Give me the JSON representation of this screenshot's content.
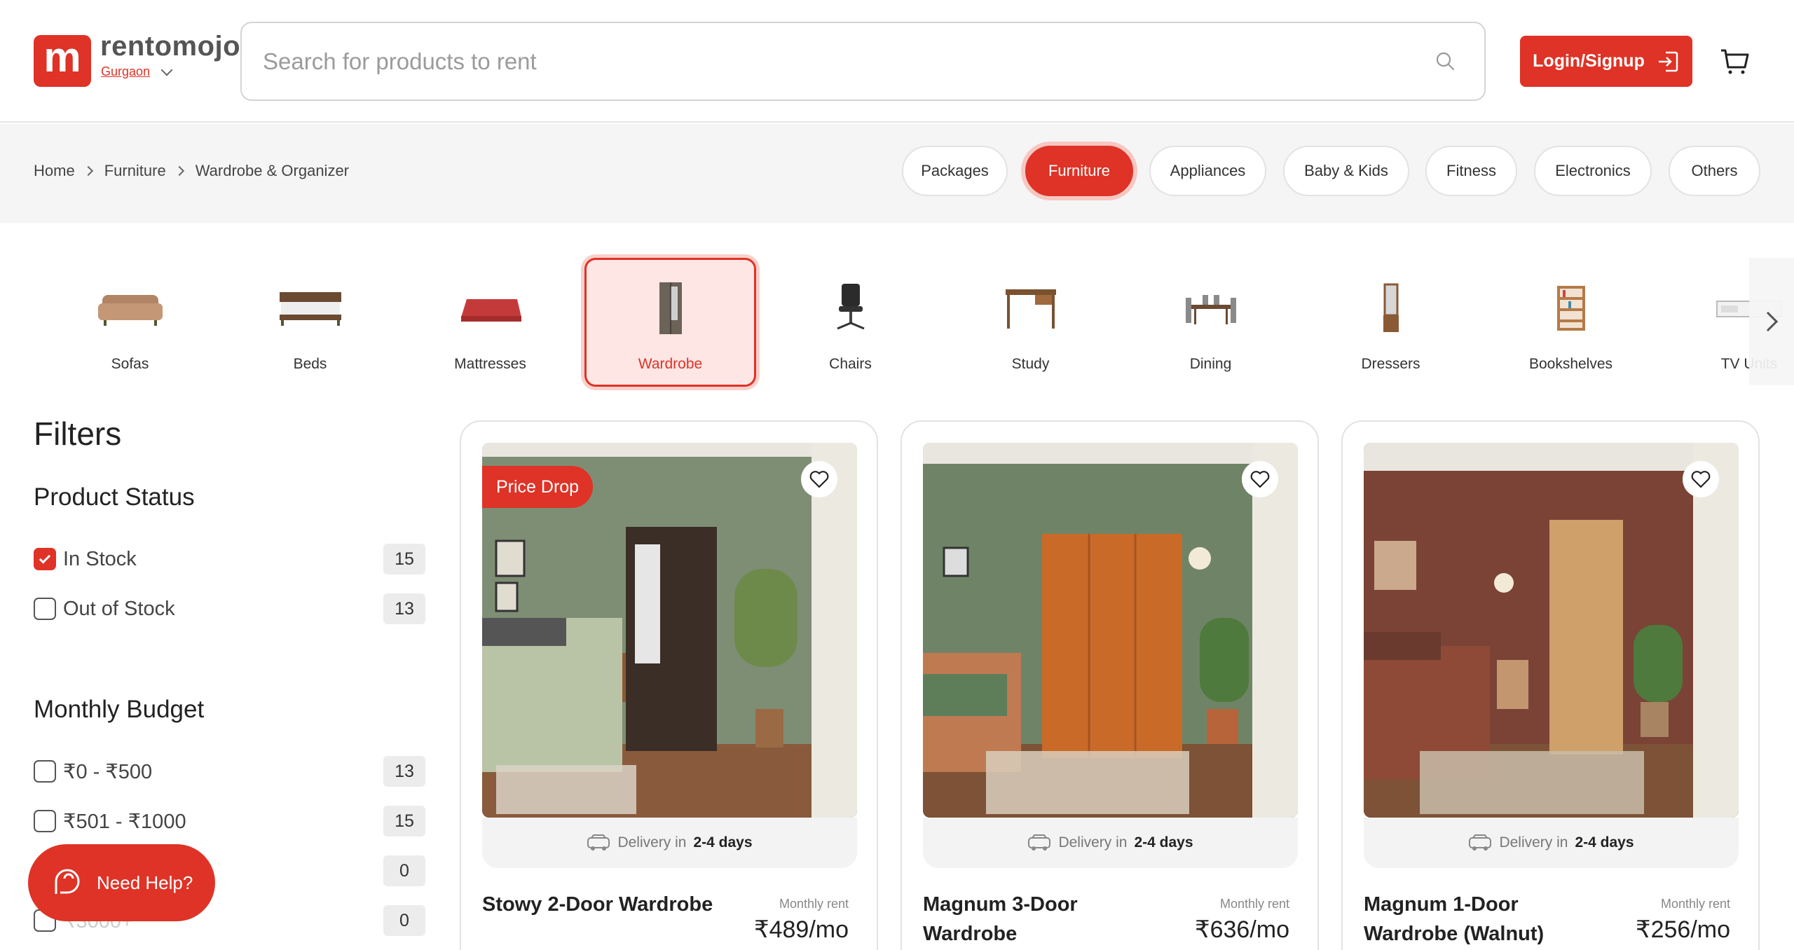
{
  "brand": {
    "name": "rentomojo",
    "logo_letter": "m",
    "city": "Gurgaon"
  },
  "search": {
    "placeholder": "Search for products to rent"
  },
  "header": {
    "login_label": "Login/Signup"
  },
  "breadcrumb": [
    "Home",
    "Furniture",
    "Wardrobe & Organizer"
  ],
  "top_categories": [
    "Packages",
    "Furniture",
    "Appliances",
    "Baby & Kids",
    "Fitness",
    "Electronics",
    "Others"
  ],
  "sub_categories": [
    "Sofas",
    "Beds",
    "Mattresses",
    "Wardrobe",
    "Chairs",
    "Study",
    "Dining",
    "Dressers",
    "Bookshelves",
    "TV Units"
  ],
  "filters": {
    "title": "Filters",
    "product_status": {
      "title": "Product Status",
      "options": [
        {
          "label": "In Stock",
          "count": "15",
          "checked": true
        },
        {
          "label": "Out of Stock",
          "count": "13",
          "checked": false
        }
      ]
    },
    "monthly_budget": {
      "title": "Monthly Budget",
      "options": [
        {
          "label": "₹0 - ₹500",
          "count": "13"
        },
        {
          "label": "₹501 - ₹1000",
          "count": "15"
        },
        {
          "label": "",
          "count": "0"
        },
        {
          "label": "₹3000+",
          "count": "0"
        }
      ]
    }
  },
  "help": {
    "label": "Need Help?"
  },
  "products": [
    {
      "name": "Stowy 2-Door Wardrobe",
      "badge": "Price Drop",
      "rent_label": "Monthly rent",
      "rent": "₹489/mo",
      "delivery_prefix": "Delivery in",
      "delivery_days": "2-4 days"
    },
    {
      "name": "Magnum 3-Door Wardrobe",
      "badge": "",
      "rent_label": "Monthly rent",
      "rent": "₹636/mo",
      "delivery_prefix": "Delivery in",
      "delivery_days": "2-4 days"
    },
    {
      "name": "Magnum 1-Door Wardrobe (Walnut)",
      "badge": "",
      "rent_label": "Monthly rent",
      "rent": "₹256/mo",
      "delivery_prefix": "Delivery in",
      "delivery_days": "2-4 days"
    }
  ],
  "colors": {
    "accent": "#de3326",
    "accent_soft": "#fde6e4",
    "band": "#f5f5f5"
  },
  "icons": [
    "search-icon",
    "login-arrow-icon",
    "cart-icon",
    "chevron-down-icon",
    "chevron-right-icon",
    "heart-icon",
    "truck-icon",
    "chat-icon",
    "check-icon"
  ]
}
